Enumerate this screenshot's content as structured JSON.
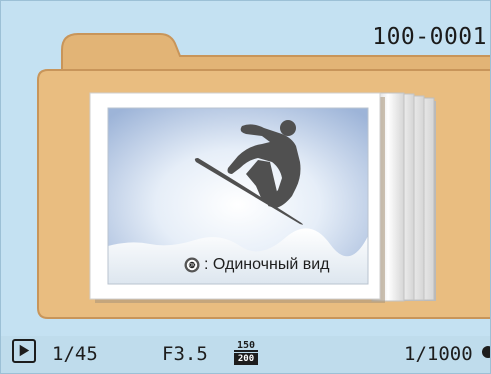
{
  "file_number": "100-0001",
  "photo": {
    "caption": ": Одиночный вид",
    "caption_icon": "dial-button-icon"
  },
  "status_bar": {
    "playback_icon": "play-icon",
    "frame_counter": "1/45",
    "aperture": "F3.5",
    "iso_top": "150",
    "iso_bottom": "200",
    "shutter": "1/1000"
  },
  "colors": {
    "background": "#c4e1f2",
    "folder": "#e8bb7c",
    "folder_shadow": "#d9a35e",
    "text": "#1d1d1d"
  }
}
